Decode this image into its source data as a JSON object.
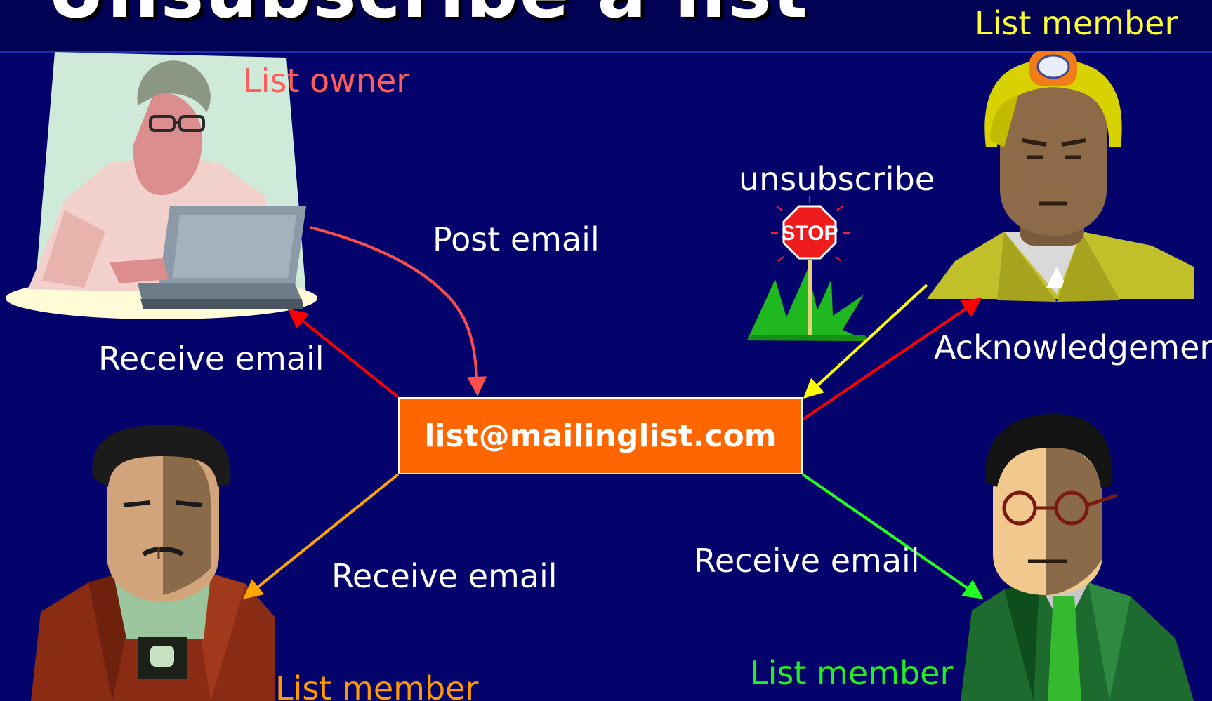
{
  "title": "Unsubscribe a list",
  "mailing_list_address": "list@mailinglist.com",
  "roles": {
    "owner": "List owner",
    "member_top_right": "List member",
    "member_bottom_left": "List member",
    "member_bottom_right": "List member"
  },
  "actions": {
    "post_email": "Post email",
    "receive_owner": "Receive email",
    "receive_bottom_left": "Receive email",
    "receive_bottom_right": "Receive email",
    "unsubscribe": "unsubscribe",
    "acknowledgement": "Acknowledgement"
  },
  "stop_sign_text": "STOP",
  "colors": {
    "background": "#03036b",
    "email_box": "#ff6600",
    "owner_label": "#ff5c5c",
    "member_top_label": "#ffff33",
    "member_bottom_left_label": "#ff9900",
    "member_bottom_right_label": "#22ee22",
    "arrow_post": "#ff4d4d",
    "arrow_receive_owner": "#ff0000",
    "arrow_receive_left": "#ffa500",
    "arrow_receive_right": "#22ff22",
    "arrow_unsubscribe": "#ffff00",
    "arrow_acknowledgement": "#ff0000"
  }
}
